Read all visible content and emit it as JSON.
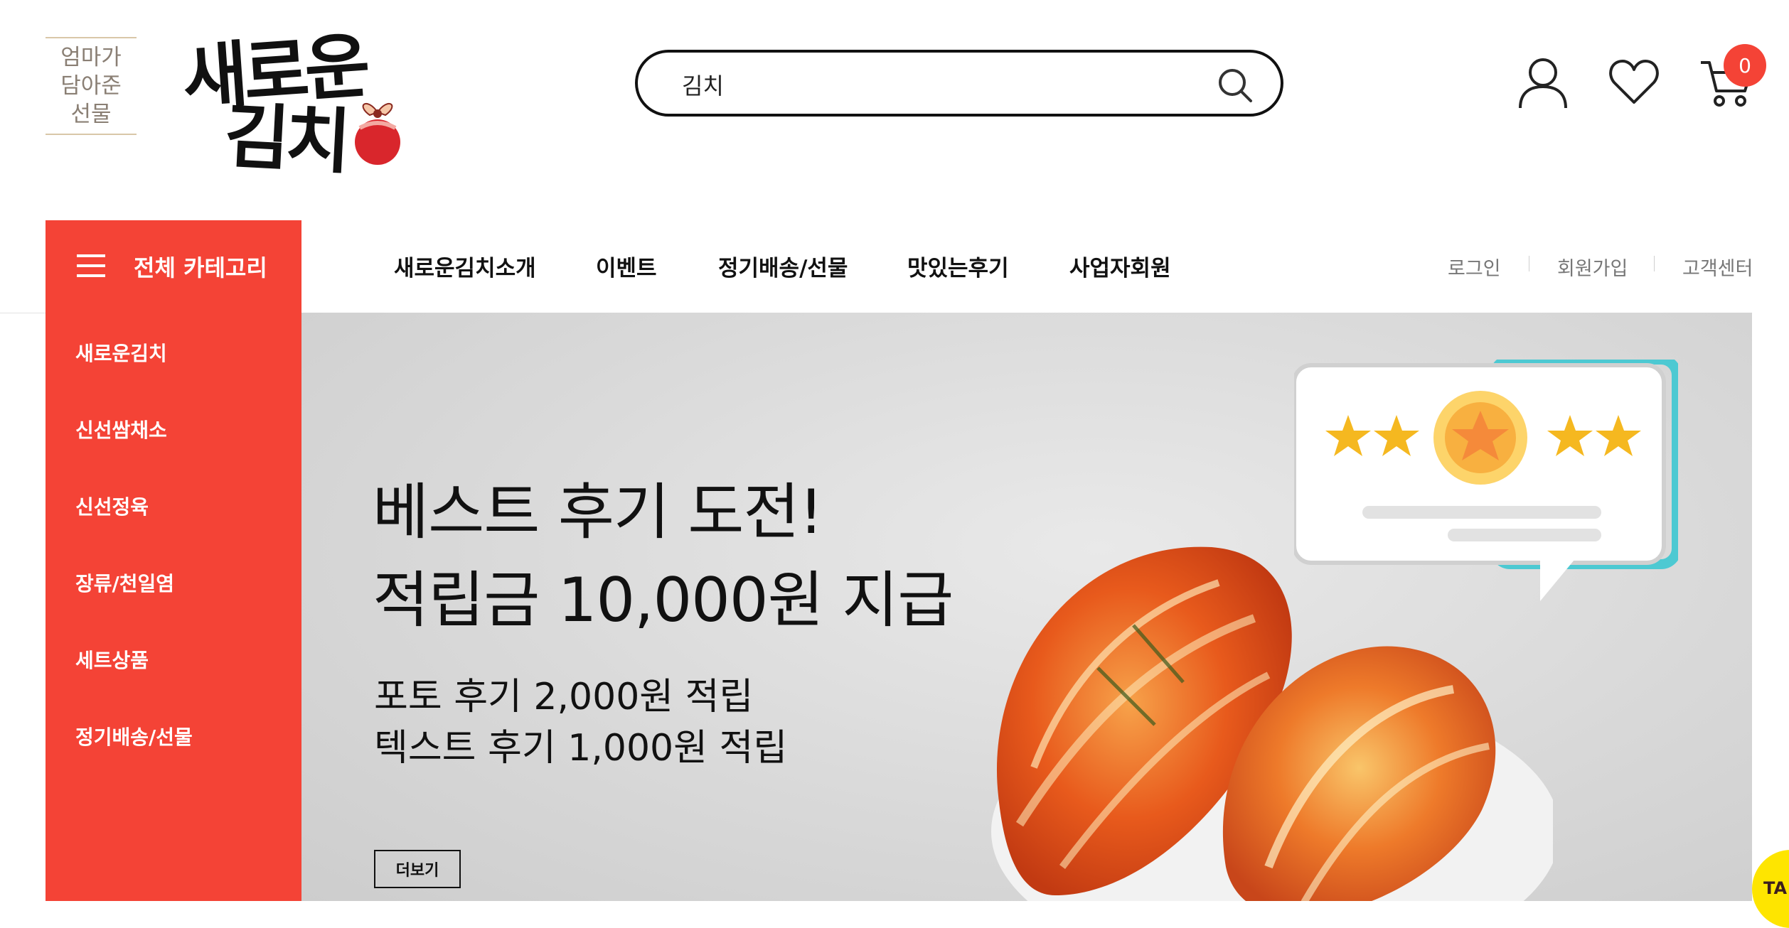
{
  "colors": {
    "accent": "#f44336",
    "text": "#111111",
    "muted": "#777777",
    "banner_bg": "#d9d9d9"
  },
  "brand": {
    "tagline_lines": [
      "엄마가",
      "담아준",
      "선물"
    ],
    "logo_line1": "새로운",
    "logo_line2": "김치"
  },
  "search": {
    "value": "김치",
    "icon": "search-icon"
  },
  "header_icons": {
    "user": "user-icon",
    "wishlist": "heart-icon",
    "cart": "cart-icon",
    "cart_count": "0"
  },
  "nav": {
    "category_button": "전체 카테고리",
    "menu": [
      "새로운김치소개",
      "이벤트",
      "정기배송/선물",
      "맛있는후기",
      "사업자회원"
    ],
    "util_links": [
      "로그인",
      "회원가입",
      "고객센터"
    ]
  },
  "categories": [
    "새로운김치",
    "신선쌈채소",
    "신선정육",
    "장류/천일염",
    "세트상품",
    "정기배송/선물"
  ],
  "banner": {
    "headline_line1": "베스트 후기 도전!",
    "headline_line2": "적립금 10,000원 지급",
    "sub_line1": "포토 후기 2,000원 적립",
    "sub_line2": "텍스트 후기 1,000원 적립",
    "more_button": "더보기",
    "rating_stars": 5
  }
}
